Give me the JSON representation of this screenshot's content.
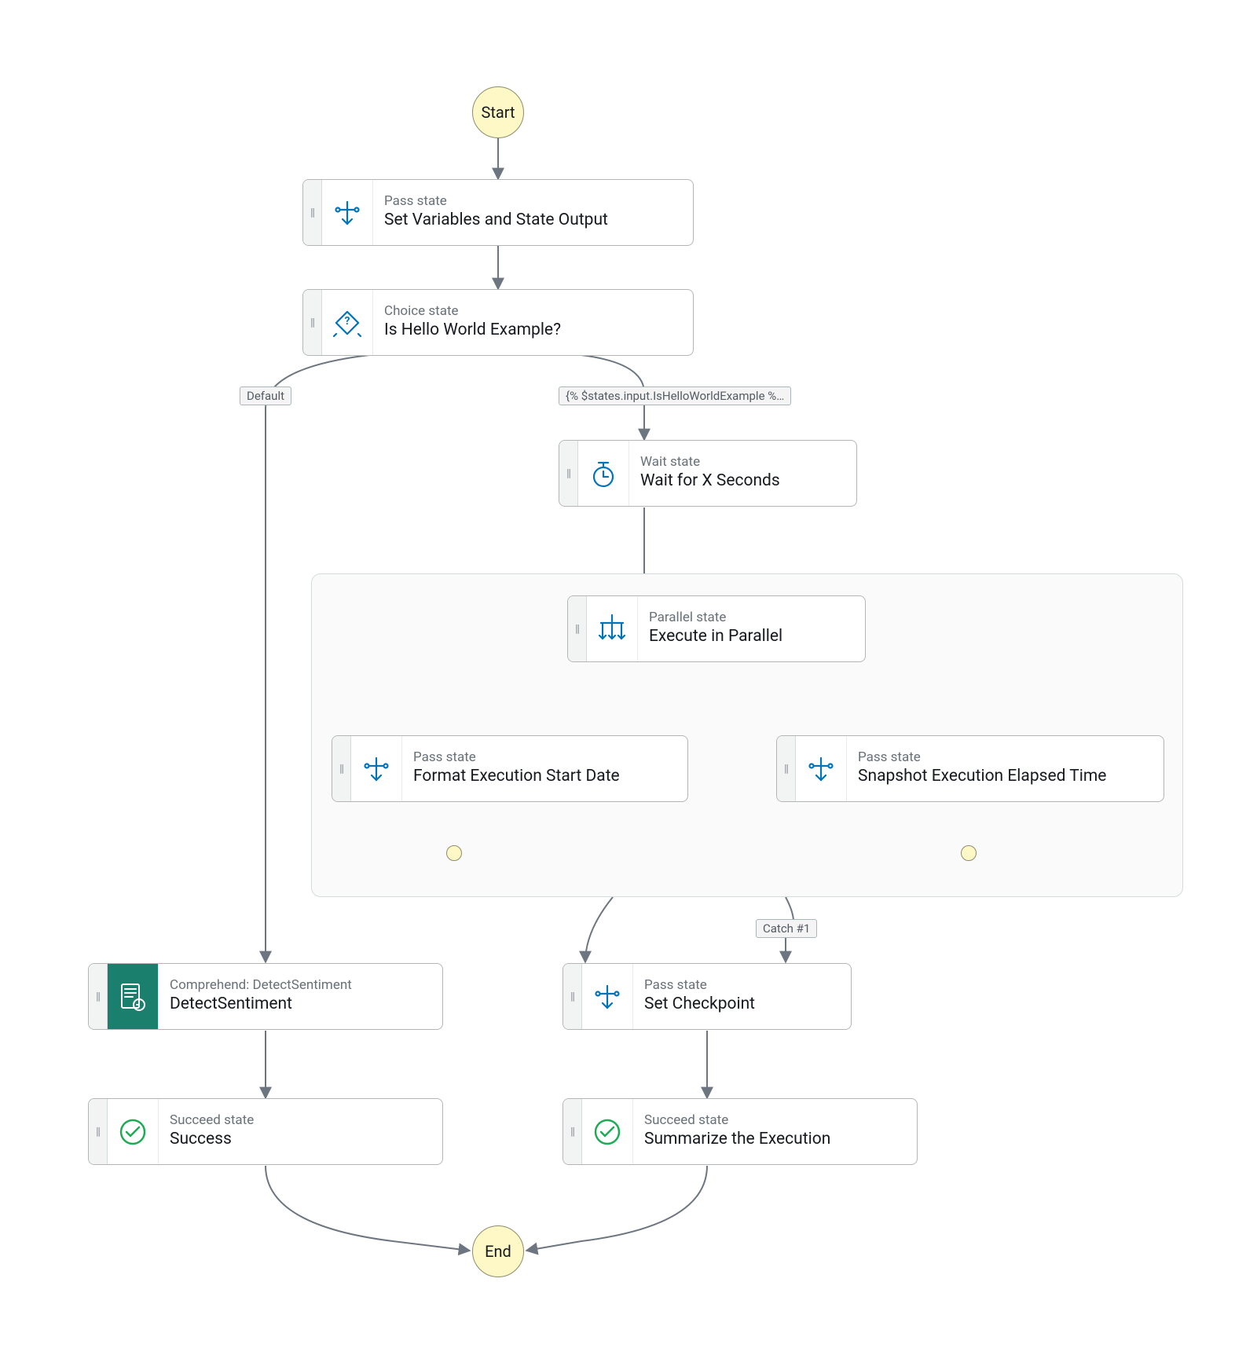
{
  "terminals": {
    "start": "Start",
    "end": "End"
  },
  "edgeLabels": {
    "default": "Default",
    "condition": "{% $states.input.IsHelloWorldExample %…",
    "catch": "Catch #1"
  },
  "states": {
    "setVars": {
      "type": "Pass state",
      "title": "Set Variables and State Output"
    },
    "choice": {
      "type": "Choice state",
      "title": "Is Hello World Example?"
    },
    "wait": {
      "type": "Wait state",
      "title": "Wait for X Seconds"
    },
    "parallel": {
      "type": "Parallel state",
      "title": "Execute in Parallel"
    },
    "formatDate": {
      "type": "Pass state",
      "title": "Format Execution Start Date"
    },
    "snapshot": {
      "type": "Pass state",
      "title": "Snapshot Execution Elapsed Time"
    },
    "detect": {
      "type": "Comprehend: DetectSentiment",
      "title": "DetectSentiment"
    },
    "setCheckpoint": {
      "type": "Pass state",
      "title": "Set Checkpoint"
    },
    "success": {
      "type": "Succeed state",
      "title": "Success"
    },
    "summarize": {
      "type": "Succeed state",
      "title": "Summarize the Execution"
    }
  }
}
